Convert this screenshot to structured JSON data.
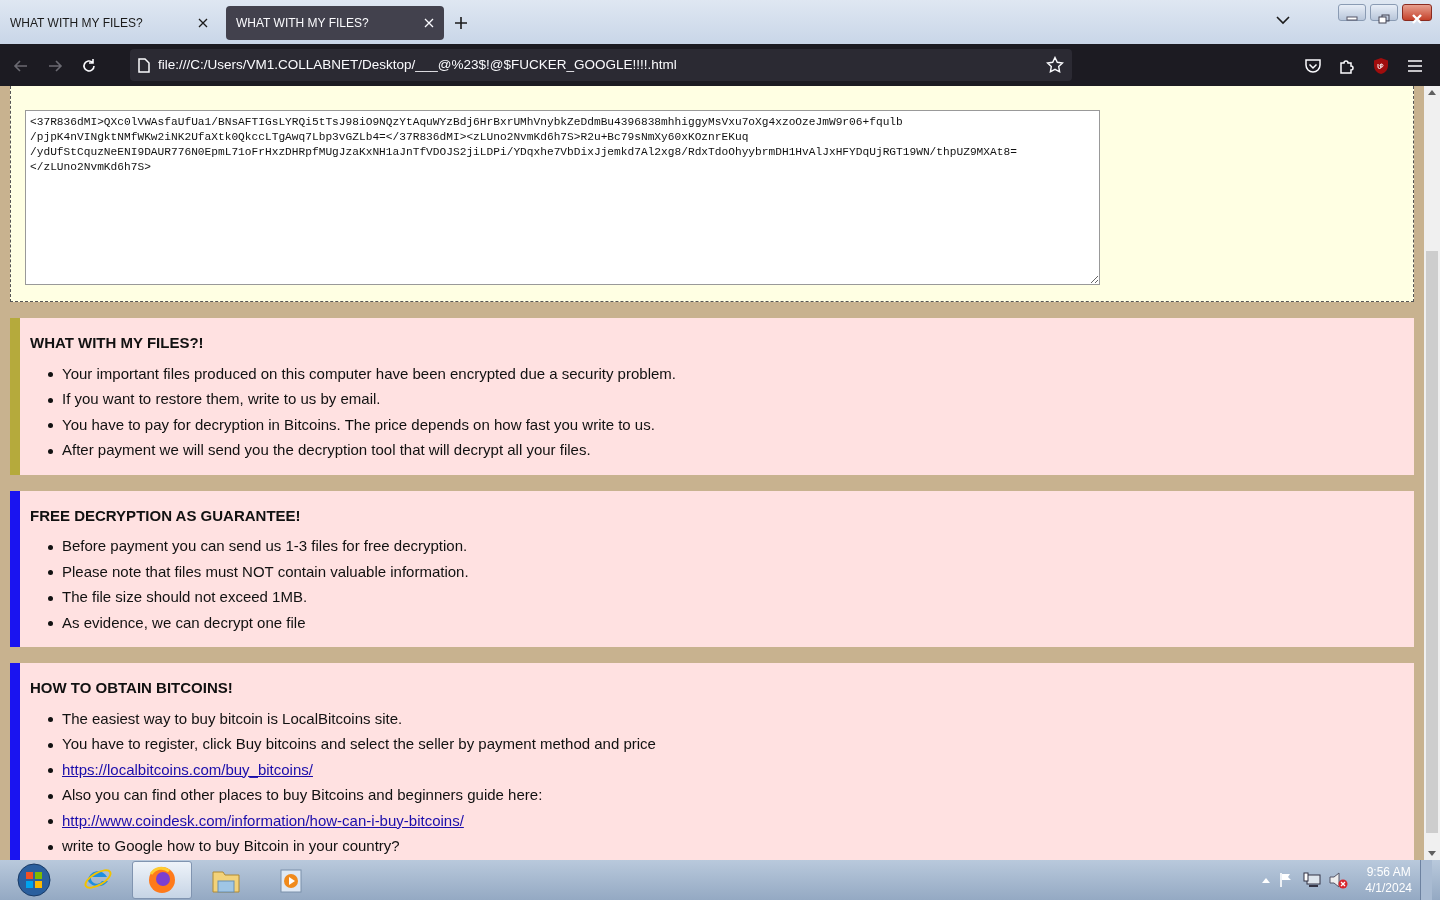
{
  "browser": {
    "tabs": [
      {
        "title": "WHAT WITH MY FILES?",
        "selected": false
      },
      {
        "title": "WHAT WITH MY FILES?",
        "selected": true
      }
    ],
    "address": "file:///C:/Users/VM1.COLLABNET/Desktop/___@%23$!@$FUCKER_GOOGLE!!!!.html"
  },
  "key_box": {
    "value": "<37R836dMI>QXc0lVWAsfaUfUa1/BNsAFTIGsLYRQi5tTsJ98iO9NQzYtAquWYzBdj6HrBxrUMhVnybkZeDdmBu4396838mhhiggyMsVxu7oXg4xzoOzeJmW9r06+fqulb\n/pjpK4nVINgktNMfWKw2iNK2UfaXtk0QkccLTgAwq7Lbp3vGZLb4=</37R836dMI><zLUno2NvmKd6h7S>R2u+Bc79sNmXy60xKOznrEKuq\n/ydUfStCquzNeENI9DAUR776N0EpmL71oFrHxzDHRpfMUgJzaKxNH1aJnTfVDOJS2jiLDPi/YDqxhe7VbDixJjemkd7Al2xg8/RdxTdoOhyybrmDH1HvAlJxHFYDqUjRGT19WN/thpUZ9MXAt8=\n</zLUno2NvmKd6h7S>"
  },
  "sections": [
    {
      "title": "WHAT WITH MY FILES?!",
      "color": "#b5aa3c",
      "items": [
        {
          "kind": "text",
          "text": "Your important files produced on this computer have been encrypted due a security problem."
        },
        {
          "kind": "text",
          "text": "If you want to restore them, write to us by email."
        },
        {
          "kind": "text",
          "text": "You have to pay for decryption in Bitcoins. The price depends on how fast you write to us."
        },
        {
          "kind": "text",
          "text": "After payment we will send you the decryption tool that will decrypt all your files."
        }
      ]
    },
    {
      "title": "FREE DECRYPTION AS GUARANTEE!",
      "color": "#1a14f0",
      "items": [
        {
          "kind": "text",
          "text": "Before payment you can send us 1-3 files for free decryption."
        },
        {
          "kind": "text",
          "text": "Please note that files must NOT contain valuable information."
        },
        {
          "kind": "text",
          "text": "The file size should not exceed 1MB."
        },
        {
          "kind": "text",
          "text": "As evidence, we can decrypt one file"
        }
      ]
    },
    {
      "title": "HOW TO OBTAIN BITCOINS!",
      "color": "#1a14f0",
      "items": [
        {
          "kind": "text",
          "text": "The easiest way to buy bitcoin is LocalBitcoins site."
        },
        {
          "kind": "text",
          "text": "You have to register, click Buy bitcoins and select the seller by payment method and price"
        },
        {
          "kind": "link",
          "text": "https://localbitcoins.com/buy_bitcoins/"
        },
        {
          "kind": "text",
          "text": "Also you can find other places to buy Bitcoins and beginners guide here:"
        },
        {
          "kind": "link",
          "text": "http://www.coindesk.com/information/how-can-i-buy-bitcoins/"
        },
        {
          "kind": "text",
          "text": "write to Google how to buy Bitcoin in your country?"
        }
      ]
    }
  ],
  "taskbar": {
    "apps": [
      {
        "kind": "ie",
        "selected": false
      },
      {
        "kind": "firefox",
        "selected": true
      },
      {
        "kind": "folder",
        "selected": false
      },
      {
        "kind": "media",
        "selected": false
      }
    ],
    "time": "9:56 AM",
    "date": "4/1/2024"
  }
}
